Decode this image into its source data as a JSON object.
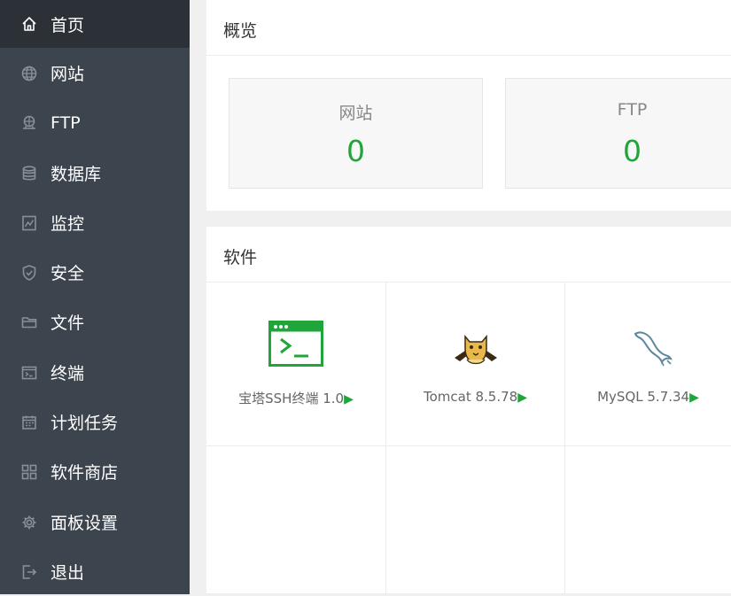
{
  "sidebar": {
    "items": [
      {
        "label": "首页",
        "icon": "home-icon",
        "active": true
      },
      {
        "label": "网站",
        "icon": "globe-icon"
      },
      {
        "label": "FTP",
        "icon": "ftp-icon"
      },
      {
        "label": "数据库",
        "icon": "database-icon"
      },
      {
        "label": "监控",
        "icon": "monitor-icon"
      },
      {
        "label": "安全",
        "icon": "shield-icon"
      },
      {
        "label": "文件",
        "icon": "folder-icon"
      },
      {
        "label": "终端",
        "icon": "terminal-icon"
      },
      {
        "label": "计划任务",
        "icon": "calendar-icon"
      },
      {
        "label": "软件商店",
        "icon": "grid-icon"
      },
      {
        "label": "面板设置",
        "icon": "gear-icon"
      },
      {
        "label": "退出",
        "icon": "logout-icon"
      }
    ]
  },
  "overview": {
    "title": "概览",
    "stats": [
      {
        "label": "网站",
        "value": "0"
      },
      {
        "label": "FTP",
        "value": "0"
      }
    ]
  },
  "software": {
    "title": "软件",
    "items": [
      {
        "name": "宝塔SSH终端 1.0",
        "icon": "terminal-app-icon"
      },
      {
        "name": "Tomcat 8.5.78",
        "icon": "tomcat-icon"
      },
      {
        "name": "MySQL 5.7.34",
        "icon": "mysql-icon"
      }
    ],
    "arrow": "▶"
  },
  "colors": {
    "sidebar_bg": "#3c444d",
    "sidebar_active_bg": "#2c3138",
    "accent_green": "#20a53a"
  }
}
